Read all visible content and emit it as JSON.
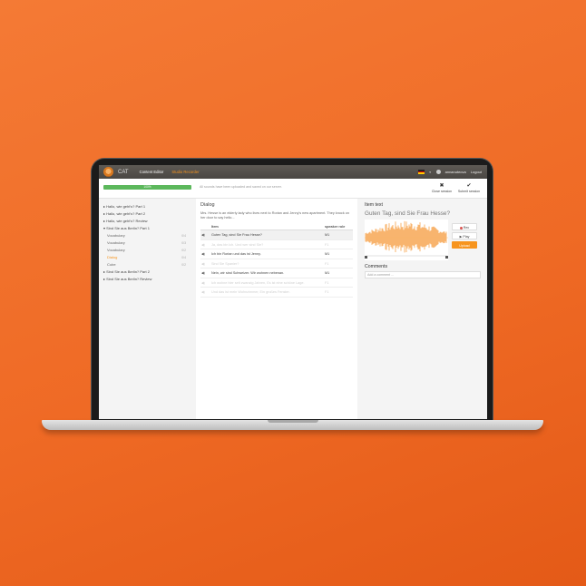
{
  "colors": {
    "accent": "#f7941d",
    "progress": "#5cb85c",
    "navbar": "#4f4b47"
  },
  "navbar": {
    "app_name": "CAT",
    "links": [
      {
        "label": "Content Editor",
        "active": false
      },
      {
        "label": "Studio Recorder",
        "active": true
      }
    ],
    "username": "annanuteova",
    "logout": "Logout"
  },
  "status": {
    "progress": 1.0,
    "progress_label": "100%",
    "message": "All sounds have been uploaded and saved on our server."
  },
  "actions": {
    "close_session": "Close session",
    "submit_session": "Submit session"
  },
  "sidebar": {
    "items": [
      {
        "label": "▸ Hallo, wie geht's? Part 1",
        "level": 0,
        "count": ""
      },
      {
        "label": "▸ Hallo, wie geht's? Part 2",
        "level": 0,
        "count": ""
      },
      {
        "label": "▸ Hallo, wie geht's? Review",
        "level": 0,
        "count": ""
      },
      {
        "label": "▾ Sind Sie aus Berlin? Part 1",
        "level": 0,
        "count": ""
      },
      {
        "label": "Vocabulary",
        "level": 1,
        "count": "0/4"
      },
      {
        "label": "Vocabulary",
        "level": 1,
        "count": "0/3"
      },
      {
        "label": "Vocabulary",
        "level": 1,
        "count": "0/2"
      },
      {
        "label": "Dialog",
        "level": 1,
        "count": "0/4",
        "current": true
      },
      {
        "label": "Cube",
        "level": 1,
        "count": "0/2"
      },
      {
        "label": "▸ Sind Sie aus Berlin? Part 2",
        "level": 0,
        "count": ""
      },
      {
        "label": "▸ Sind Sie aus Berlin? Review",
        "level": 0,
        "count": ""
      }
    ]
  },
  "dialog": {
    "title": "Dialog",
    "description": "Mrs. Hesse is an elderly lady who lives next to Rorian and Jenny's new apartment. They knock on her door to say hello...",
    "headers": {
      "item": "Item",
      "role": "speaker role"
    },
    "rows": [
      {
        "text": "Guten Tag, sind Sie Frau Hesse?",
        "role": "M1",
        "state": "selected"
      },
      {
        "text": "Ja, das bin ich. Und wer sind Sie?",
        "role": "F1",
        "state": "dim"
      },
      {
        "text": "Ich bin Rorian und das ist Jenny.",
        "role": "M1",
        "state": "normal"
      },
      {
        "text": "Sind Sie Spanier?",
        "role": "F1",
        "state": "dim"
      },
      {
        "text": "Nein, wir sind Schweizer. Wir wohnen nebenan.",
        "role": "M1",
        "state": "normal"
      },
      {
        "text": "Ich wohne hier seit zwanzig Jahren, Es ist eine schöne Lage.",
        "role": "F1",
        "state": "dim"
      },
      {
        "text": "Und das ist mein Wohnzimmer, Ein großes Fenster.",
        "role": "F1",
        "state": "dim"
      }
    ]
  },
  "panel": {
    "item_text_title": "Item text",
    "item_text": "Guten Tag, sind Sie Frau Hesse?",
    "rec_label": "Rec",
    "play_label": "▶ Play",
    "upload_label": "Upload",
    "comments_title": "Comments",
    "comment_placeholder": "Add a comment ..."
  }
}
